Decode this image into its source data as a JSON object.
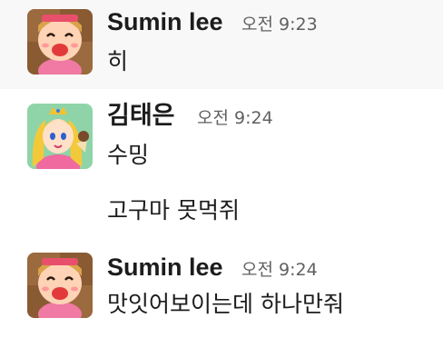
{
  "messages": [
    {
      "author": "Sumin lee",
      "avatar_icon": "cartoon-girl-avatar-icon",
      "time": "오전 9:23",
      "text": "히"
    },
    {
      "author": "김태은",
      "avatar_icon": "princess-peach-avatar-icon",
      "time": "오전 9:24",
      "text": "수밍",
      "continuation": "고구마 못먹쥐"
    },
    {
      "author": "Sumin lee",
      "avatar_icon": "cartoon-girl-avatar-icon",
      "time": "오전 9:24",
      "text": "맛잇어보이는데 하나만줘"
    }
  ],
  "colors": {
    "hover_bg": "#f8f8f8",
    "text": "#1d1c1d",
    "timestamp": "#616061"
  }
}
